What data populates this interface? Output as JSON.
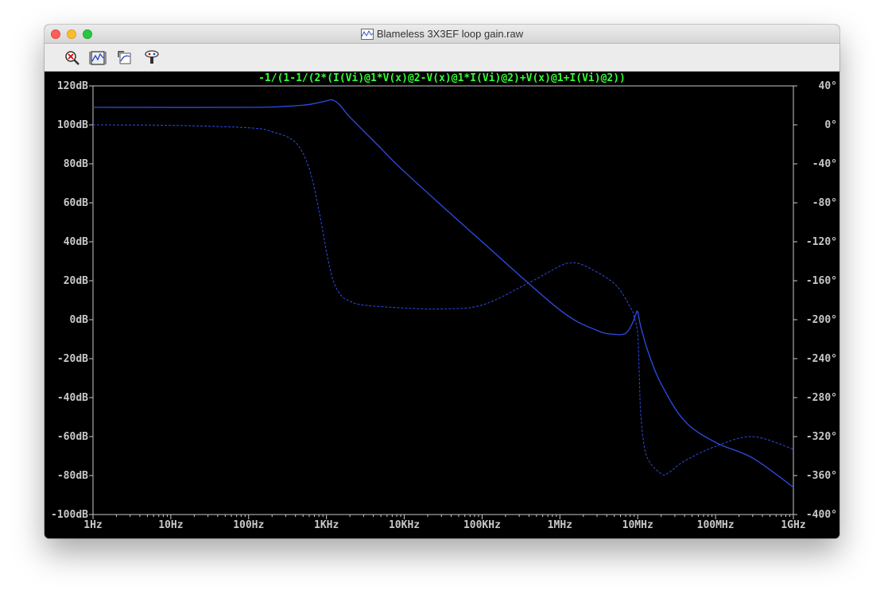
{
  "window": {
    "title": "Blameless 3X3EF loop gain.raw"
  },
  "toolbar": {
    "buttons": [
      {
        "icon": "zoom-cancel-icon"
      },
      {
        "icon": "autorange-icon"
      },
      {
        "icon": "fit-icon"
      },
      {
        "icon": "probe-icon"
      }
    ]
  },
  "colors": {
    "trace": "#2d4de6",
    "grid_text": "#c8c8c8",
    "expression": "#33ff33",
    "background": "#000000"
  },
  "chart_data": {
    "type": "line",
    "title": "-1/(1-1/(2*(I(Vi)@1*V(x)@2-V(x)@1*I(Vi)@2)+V(x)@1+I(Vi)@2))",
    "x_scale": "log",
    "x_ticks": [
      "1Hz",
      "10Hz",
      "100Hz",
      "1KHz",
      "10KHz",
      "100KHz",
      "1MHz",
      "10MHz",
      "100MHz",
      "1GHz"
    ],
    "xlim": [
      1,
      1000000000
    ],
    "y_left_ticks": [
      "120dB",
      "100dB",
      "80dB",
      "60dB",
      "40dB",
      "20dB",
      "0dB",
      "-20dB",
      "-40dB",
      "-60dB",
      "-80dB",
      "-100dB"
    ],
    "ylim_left": [
      -100,
      120
    ],
    "y_right_ticks": [
      "40°",
      "0°",
      "-40°",
      "-80°",
      "-120°",
      "-160°",
      "-200°",
      "-240°",
      "-280°",
      "-320°",
      "-360°",
      "-400°"
    ],
    "ylim_right": [
      -400,
      40
    ],
    "series": [
      {
        "style": "solid",
        "axis": "left",
        "x": [
          1,
          100,
          300,
          600,
          1000,
          1200,
          1500,
          2000,
          5000,
          10000,
          100000,
          1000000,
          3000000,
          5000000,
          7000000,
          8500000,
          9500000,
          10000000,
          11000000,
          14000000,
          20000000,
          40000000,
          100000000,
          300000000,
          1000000000
        ],
        "y": [
          109,
          109,
          109.5,
          110.5,
          112.3,
          112.8,
          110,
          104,
          88,
          76,
          40,
          5,
          -5.5,
          -7.5,
          -7,
          -2,
          3,
          4,
          -4,
          -18,
          -33,
          -52,
          -63,
          -71,
          -86
        ]
      },
      {
        "style": "dashed",
        "axis": "right",
        "x": [
          1,
          10,
          100,
          200,
          400,
          600,
          800,
          1000,
          1200,
          1500,
          2000,
          3000,
          10000,
          30000,
          100000,
          400000,
          1000000,
          1300000,
          2000000,
          5000000,
          8000000,
          9000000,
          10000000,
          10500000,
          11000000,
          13000000,
          20000000,
          25000000,
          40000000,
          100000000,
          300000000,
          1000000000
        ],
        "y": [
          0,
          -0.5,
          -3,
          -7,
          -18,
          -45,
          -88,
          -130,
          -158,
          -174,
          -181,
          -185,
          -188,
          -189,
          -185,
          -162,
          -145,
          -142,
          -144,
          -163,
          -187,
          -197,
          -215,
          -260,
          -300,
          -340,
          -358,
          -357,
          -345,
          -330,
          -320,
          -333
        ]
      }
    ]
  }
}
